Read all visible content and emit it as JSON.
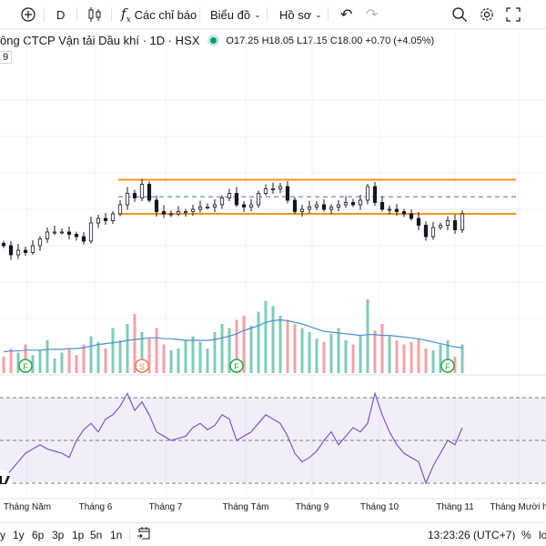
{
  "toolbar": {
    "interval": "D",
    "indicators_label": "Các chỉ báo",
    "chart_label": "Biểu đồ",
    "profile_label": "Hồ sơ"
  },
  "legend": {
    "title": "ông CTCP Vận tải Dầu khí · 1D · HSX",
    "open": "O17.25",
    "high": "H18.05",
    "low": "L17.15",
    "close": "C18.00",
    "change": "+0.70 (+4.05%)",
    "badge": "9"
  },
  "time_axis": [
    "Tháng Năm",
    "Tháng 6",
    "Tháng 7",
    "Tháng Tám",
    "Tháng 9",
    "Tháng 10",
    "Tháng 11",
    "Tháng Mười h"
  ],
  "bottom": {
    "ranges": [
      "y",
      "1y",
      "6p",
      "3p",
      "1p",
      "5n",
      "1n"
    ],
    "clock": "13:23:26 (UTC+7)",
    "percent": "%",
    "log": "lo"
  },
  "colors": {
    "up": "#26a69a",
    "down": "#ef5350",
    "vol_up": "#7fcbb9",
    "vol_down": "#f7a1a6",
    "level": "#f7931a",
    "rsi": "#7e57c2",
    "ma": "#4a90d9"
  },
  "events": [
    {
      "label": "F",
      "type": "dividend",
      "index": 3
    },
    {
      "label": "S",
      "type": "split",
      "index": 19
    },
    {
      "label": "F",
      "type": "dividend",
      "index": 32
    },
    {
      "label": "F",
      "type": "dividend",
      "index": 61
    }
  ],
  "levels": {
    "resistance": 19.5,
    "middle": 18.75,
    "support": 18.0
  },
  "chart_data": {
    "type": "candlestick",
    "closes": [
      16.6,
      16.2,
      16.4,
      16.3,
      16.6,
      16.9,
      17.2,
      17.2,
      17.2,
      17.1,
      17.0,
      16.8,
      17.6,
      17.8,
      17.7,
      18.0,
      18.4,
      18.9,
      18.7,
      19.3,
      18.6,
      18.1,
      18.0,
      18.0,
      18.1,
      18.1,
      18.2,
      18.3,
      18.3,
      18.4,
      18.7,
      18.9,
      18.4,
      18.3,
      18.4,
      18.9,
      19.1,
      19.1,
      19.2,
      18.6,
      18.1,
      18.2,
      18.3,
      18.4,
      18.2,
      18.3,
      18.4,
      18.5,
      18.4,
      18.6,
      19.2,
      18.5,
      18.2,
      18.2,
      18.1,
      18.0,
      17.8,
      17.5,
      17.0,
      17.4,
      17.5,
      17.7,
      17.3,
      18.0
    ],
    "volume": [
      20,
      30,
      25,
      35,
      22,
      28,
      40,
      18,
      25,
      30,
      22,
      35,
      45,
      38,
      30,
      55,
      40,
      60,
      72,
      50,
      42,
      55,
      35,
      28,
      30,
      40,
      45,
      38,
      30,
      50,
      60,
      55,
      65,
      70,
      58,
      75,
      88,
      82,
      70,
      65,
      60,
      55,
      50,
      42,
      38,
      48,
      55,
      40,
      35,
      45,
      90,
      52,
      60,
      45,
      40,
      35,
      38,
      42,
      30,
      28,
      35,
      40,
      20,
      35
    ],
    "volume_ma": [
      26,
      27,
      27,
      28,
      28,
      28,
      29,
      29,
      29,
      30,
      30,
      31,
      33,
      35,
      36,
      37,
      38,
      40,
      41,
      42,
      43,
      43,
      42,
      42,
      41,
      40,
      40,
      40,
      40,
      41,
      43,
      45,
      48,
      52,
      55,
      58,
      62,
      64,
      65,
      64,
      62,
      60,
      57,
      54,
      51,
      50,
      49,
      48,
      47,
      46,
      47,
      47,
      46,
      46,
      45,
      44,
      43,
      42,
      40,
      38,
      36,
      34,
      32,
      31
    ],
    "rsi": [
      32,
      36,
      40,
      44,
      46,
      48,
      46,
      45,
      44,
      42,
      50,
      55,
      58,
      54,
      60,
      62,
      66,
      72,
      64,
      68,
      62,
      54,
      52,
      50,
      51,
      52,
      56,
      58,
      55,
      57,
      62,
      60,
      50,
      52,
      54,
      58,
      62,
      60,
      58,
      52,
      44,
      40,
      42,
      45,
      50,
      54,
      48,
      52,
      56,
      54,
      58,
      72,
      62,
      54,
      48,
      44,
      42,
      40,
      30,
      38,
      44,
      50,
      48,
      56
    ],
    "rsi_levels": [
      70,
      50,
      30
    ],
    "ylim": [
      15.6,
      20.0
    ]
  }
}
